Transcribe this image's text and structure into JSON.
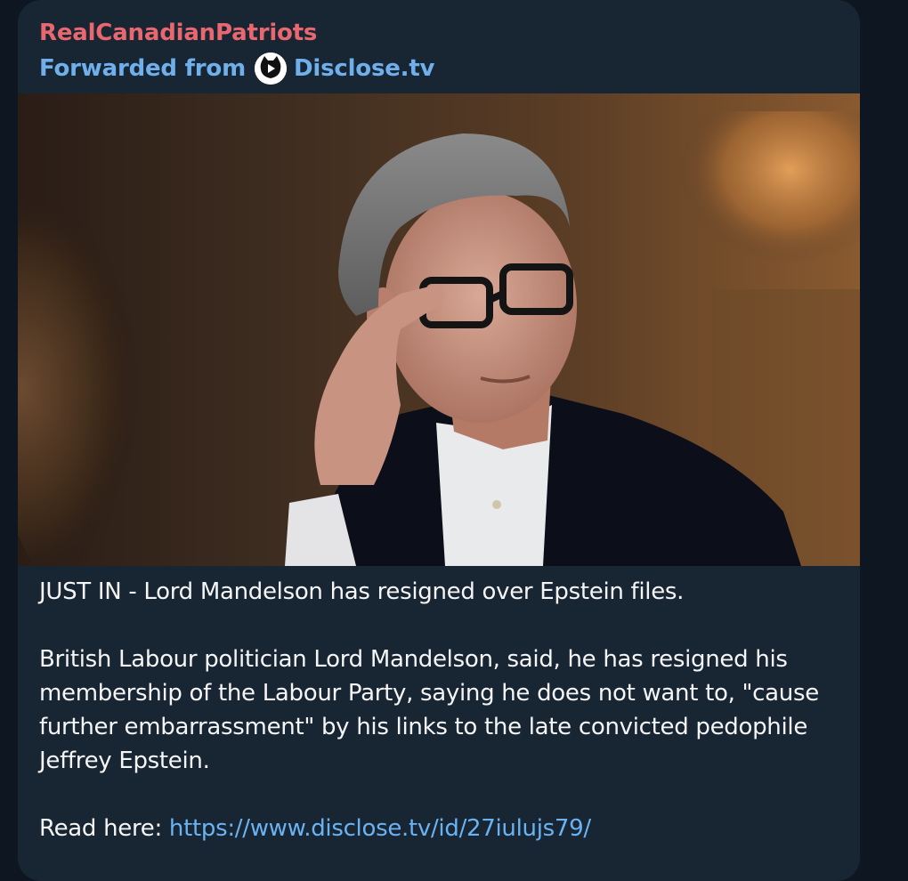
{
  "message": {
    "sender": "RealCanadianPatriots",
    "forwarded_prefix": "Forwarded from",
    "forwarded_source": "Disclose.tv",
    "source_avatar_icon": "disclose-tv-logo-icon",
    "photo": {
      "description_icon": "news-photo",
      "alt": ""
    },
    "headline": "JUST IN - Lord Mandelson has resigned over Epstein files.",
    "body": "British Labour politician Lord Mandelson, said, he has resigned his membership of the Labour Party, saying he does not want to, \"cause further embarrassment\" by his links to the late convicted pedophile Jeffrey Epstein.",
    "read_here_label": "Read here:",
    "link": "https://www.disclose.tv/id/27iulujs79/"
  },
  "colors": {
    "background": "#0e1621",
    "bubble": "#182533",
    "sender": "#e9676f",
    "forwarded": "#6fb0ec",
    "text": "#f5f5f5",
    "link": "#6ab3f3"
  }
}
